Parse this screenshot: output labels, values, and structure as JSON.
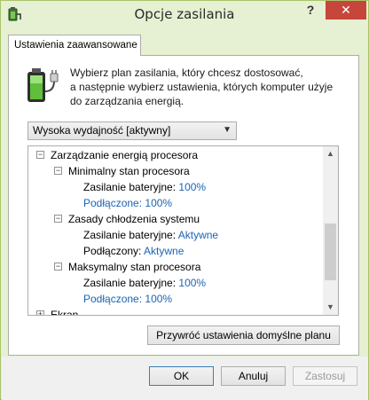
{
  "window": {
    "title": "Opcje zasilania",
    "help_label": "?",
    "close_label": "✕"
  },
  "tab": {
    "label": "Ustawienia zaawansowane"
  },
  "description": {
    "line1": "Wybierz plan zasilania, który chcesz dostosować,",
    "line2": "a następnie wybierz ustawienia, których komputer użyje",
    "line3": "do zarządzania energią."
  },
  "plan_select": {
    "value": "Wysoka wydajność [aktywny]"
  },
  "tree": {
    "root": "Zarządzanie energią procesora",
    "min_state": {
      "label": "Minimalny stan procesora",
      "battery_label": "Zasilanie bateryjne:",
      "battery_value": "100%",
      "plugged_label": "Podłączone:",
      "plugged_value": "100%"
    },
    "cooling": {
      "label": "Zasady chłodzenia systemu",
      "battery_label": "Zasilanie bateryjne:",
      "battery_value": "Aktywne",
      "plugged_label": "Podłączony:",
      "plugged_value": "Aktywne"
    },
    "max_state": {
      "label": "Maksymalny stan procesora",
      "battery_label": "Zasilanie bateryjne:",
      "battery_value": "100%",
      "plugged_label": "Podłączone:",
      "plugged_value": "100%"
    },
    "next_partial": "Ekran"
  },
  "buttons": {
    "restore": "Przywróć ustawienia domyślne planu",
    "ok": "OK",
    "cancel": "Anuluj",
    "apply": "Zastosuj"
  },
  "icons": {
    "app": "power-options-icon",
    "battery": "battery-plug-icon",
    "expand": "expand-icon",
    "collapse": "collapse-icon"
  },
  "colors": {
    "frame": "#e6f0d2",
    "close_button": "#c7463b",
    "value_text": "#1a64b5"
  }
}
